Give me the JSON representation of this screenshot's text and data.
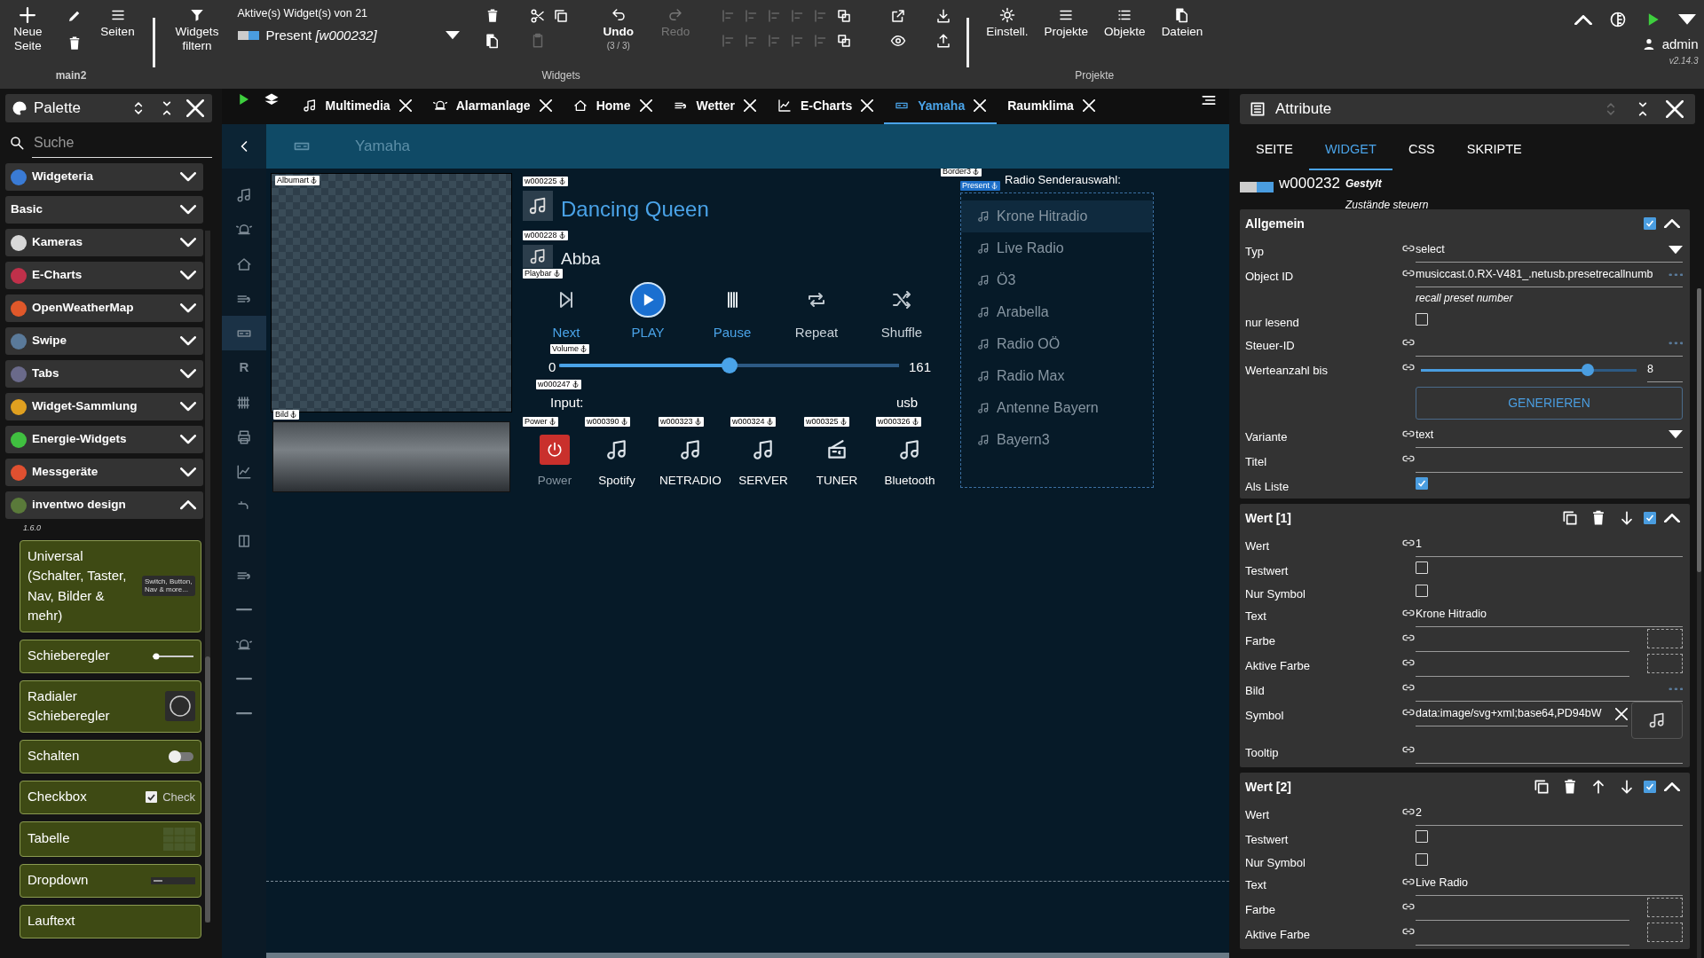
{
  "toolbar": {
    "page_buttons": [
      {
        "kind": "plus",
        "label": "Neue Seite"
      },
      {
        "kind": "pencil"
      },
      {
        "kind": "trash"
      },
      {
        "kind": "menu",
        "label": "Seiten"
      }
    ],
    "page_caption": "main2",
    "filter_button": "Widgets filtern",
    "active_widgets": {
      "label": "Aktive(s) Widget(s) von 21",
      "value": "Present *[w000232]*"
    },
    "edit_tools": [
      [
        {
          "kind": "trash",
          "disabled": false
        },
        {
          "kind": "files",
          "disabled": false
        }
      ],
      [
        {
          "kind": "cut",
          "disabled": false
        },
        {
          "kind": "copy",
          "disabled": false
        },
        {
          "kind": "paste",
          "disabled": true
        }
      ]
    ],
    "undo": {
      "label": "Undo",
      "count": "(3 / 3)",
      "disabled": false
    },
    "redo": {
      "label": "Redo",
      "disabled": true
    },
    "arrange_tools": [
      [
        {
          "kind": "align",
          "disabled": true
        },
        {
          "kind": "align",
          "disabled": true
        },
        {
          "kind": "align",
          "disabled": true
        },
        {
          "kind": "align",
          "disabled": true
        },
        {
          "kind": "align",
          "disabled": true
        },
        {
          "kind": "layers",
          "disabled": false
        },
        {
          "kind": "align",
          "disabled": true
        },
        {
          "kind": "align",
          "disabled": true
        },
        {
          "kind": "align",
          "disabled": true
        },
        {
          "kind": "align",
          "disabled": true
        },
        {
          "kind": "align",
          "disabled": true
        },
        {
          "kind": "layers",
          "disabled": false
        }
      ],
      [
        {
          "kind": "external",
          "disabled": false
        },
        {
          "kind": "eye",
          "disabled": false
        }
      ],
      [
        {
          "kind": "download",
          "disabled": false
        },
        {
          "kind": "upload",
          "disabled": false
        }
      ]
    ],
    "widgets_caption": "Widgets",
    "project_buttons": [
      {
        "kind": "gear",
        "label": "Einstell."
      },
      {
        "kind": "menu",
        "label": "Projekte"
      },
      {
        "kind": "list",
        "label": "Objekte"
      },
      {
        "kind": "files",
        "label": "Dateien"
      }
    ],
    "projects_caption": "Projekte",
    "user": "admin",
    "version": "v2.14.3"
  },
  "palette": {
    "title": "Palette",
    "search": {
      "placeholder": "Suche"
    },
    "categories": [
      {
        "name": "Widgeteria",
        "expanded": false,
        "color": "#3a7bd5"
      },
      {
        "name": "Basic",
        "expanded": false
      },
      {
        "name": "Kameras",
        "expanded": false,
        "color": "#d8d8d8"
      },
      {
        "name": "E-Charts",
        "expanded": false,
        "color": "#c0304a"
      },
      {
        "name": "OpenWeatherMap",
        "expanded": false,
        "color": "#e0582a"
      },
      {
        "name": "Swipe",
        "expanded": false,
        "color": "#5a7a9a"
      },
      {
        "name": "Tabs",
        "expanded": false,
        "color": "#6a6a8a"
      },
      {
        "name": "Widget-Sammlung",
        "expanded": false,
        "color": "#e0a020"
      },
      {
        "name": "Energie-Widgets",
        "expanded": false,
        "color": "#40c040"
      },
      {
        "name": "Messgeräte",
        "expanded": false,
        "color": "#e05030"
      },
      {
        "name": "inventwo design",
        "expanded": true,
        "color": "#5a7a3a",
        "version": "1.6.0",
        "widgets": [
          {
            "name": "Universal (Schalter, Taster, Nav, Bilder & mehr)",
            "kind": "universal",
            "preview": "Switch, Button, Nav & more..."
          },
          {
            "name": "Schieberegler",
            "kind": "slider"
          },
          {
            "name": "Radialer Schieberegler",
            "kind": "radial"
          },
          {
            "name": "Schalten",
            "kind": "switch"
          },
          {
            "name": "Checkbox",
            "kind": "checkbox",
            "preview": "Check"
          },
          {
            "name": "Tabelle",
            "kind": "table"
          },
          {
            "name": "Dropdown",
            "kind": "dropdown"
          },
          {
            "name": "Lauftext",
            "kind": "text"
          }
        ]
      }
    ]
  },
  "views": {
    "tabs": [
      {
        "label": "Multimedia",
        "kind": "music",
        "selected": false
      },
      {
        "label": "Alarmanlage",
        "kind": "alarm",
        "selected": false
      },
      {
        "label": "Home",
        "kind": "home",
        "selected": false
      },
      {
        "label": "Wetter",
        "kind": "weather",
        "selected": false
      },
      {
        "label": "E-Charts",
        "kind": "chart",
        "selected": false
      },
      {
        "label": "Yamaha",
        "kind": "receiver",
        "selected": true
      },
      {
        "label": "Raumklima",
        "selected": false
      }
    ],
    "header": "Yamaha",
    "side_nav": [
      {
        "kind": "music",
        "selected": false
      },
      {
        "kind": "alarm",
        "selected": false
      },
      {
        "kind": "home",
        "selected": false
      },
      {
        "kind": "weather",
        "selected": false
      },
      {
        "kind": "receiver",
        "selected": true
      },
      {
        "kind": "letter",
        "label": "R",
        "selected": false
      },
      {
        "kind": "radiator",
        "selected": false
      },
      {
        "kind": "printer",
        "selected": false
      },
      {
        "kind": "chart",
        "selected": false
      },
      {
        "kind": "tap",
        "selected": false
      },
      {
        "kind": "panel",
        "selected": false
      },
      {
        "kind": "weather",
        "selected": false
      },
      {
        "kind": "dash",
        "selected": false
      },
      {
        "kind": "alarm",
        "selected": false
      },
      {
        "kind": "dash",
        "selected": false
      },
      {
        "kind": "dash",
        "selected": false
      }
    ]
  },
  "canvas": {
    "albumart": {
      "tag": "Albumart"
    },
    "receiver_image": {
      "tag": "Bild"
    },
    "title": {
      "tag": "w000225",
      "text": "Dancing Queen"
    },
    "artist": {
      "tag": "w000228",
      "text": "Abba"
    },
    "playbar": {
      "tag": "Playbar",
      "buttons": [
        {
          "kind": "next",
          "label": "Next"
        },
        {
          "kind": "play",
          "label": "PLAY"
        },
        {
          "kind": "pause",
          "label": "Pause"
        },
        {
          "kind": "repeat",
          "label": "Repeat"
        },
        {
          "kind": "shuffle",
          "label": "Shuffle"
        }
      ]
    },
    "volume": {
      "tag": "Volume",
      "min": "0",
      "max": "161",
      "level": 0.5
    },
    "input": {
      "tag": "w000247",
      "label": "Input:",
      "value": "usb"
    },
    "sources": [
      {
        "kind": "power",
        "tag": "Power",
        "label": "Power"
      },
      {
        "kind": "music",
        "tag": "w000390",
        "label": "Spotify"
      },
      {
        "kind": "music",
        "tag": "w000323",
        "label": "NETRADIO"
      },
      {
        "kind": "music",
        "tag": "w000324",
        "label": "SERVER"
      },
      {
        "kind": "radio",
        "tag": "w000325",
        "label": "TUNER"
      },
      {
        "kind": "music",
        "tag": "w000326",
        "label": "Bluetooth"
      }
    ],
    "radio": {
      "tags": [
        "Border3",
        "Present"
      ],
      "title": "Radio Senderauswahl:",
      "stations": [
        {
          "name": "Krone Hitradio",
          "selected": true
        },
        {
          "name": "Live Radio",
          "selected": false
        },
        {
          "name": "Ö3",
          "selected": false
        },
        {
          "name": "Arabella",
          "selected": false
        },
        {
          "name": "Radio OÖ",
          "selected": false
        },
        {
          "name": "Radio Max",
          "selected": false
        },
        {
          "name": "Antenne Bayern",
          "selected": false
        },
        {
          "name": "Bayern3",
          "selected": false
        }
      ]
    }
  },
  "attributes": {
    "title": "Attribute",
    "tabs": [
      {
        "label": "SEITE",
        "selected": false
      },
      {
        "label": "WIDGET",
        "selected": true
      },
      {
        "label": "CSS",
        "selected": false
      },
      {
        "label": "SKRIPTE",
        "selected": false
      }
    ],
    "widget": {
      "id": "w000232",
      "styled": "Gestylt",
      "states": "Zustände steuern"
    },
    "sections": [
      {
        "title": "Allgemein",
        "enabled": true,
        "expanded": true,
        "fields": [
          {
            "label": "Typ",
            "kind": "select",
            "binding": true,
            "value": "select"
          },
          {
            "label": "Object ID",
            "kind": "text",
            "binding": true,
            "value": "musiccast.0.RX-V481_.netusb.presetrecallnumb",
            "more": true,
            "hint": "recall preset number"
          },
          {
            "label": "nur lesend",
            "kind": "checkbox",
            "binding": false,
            "checked": false
          },
          {
            "label": "Steuer-ID",
            "kind": "text",
            "binding": true,
            "more": true
          },
          {
            "label": "Werteanzahl bis",
            "kind": "slider",
            "binding": true,
            "level": 0.79,
            "value": "8"
          },
          {
            "kind": "button",
            "text": "GENERIEREN"
          },
          {
            "label": "Variante",
            "kind": "select",
            "binding": true,
            "value": "text"
          },
          {
            "label": "Titel",
            "kind": "text",
            "binding": true
          },
          {
            "label": "Als Liste",
            "kind": "checkbox",
            "binding": false,
            "checked": true
          }
        ]
      },
      {
        "title": "Wert [1]",
        "actions": [
          {
            "kind": "copy"
          },
          {
            "kind": "trash"
          },
          {
            "kind": "arrowdown"
          }
        ],
        "enabled": true,
        "expanded": true,
        "fields": [
          {
            "label": "Wert",
            "kind": "text",
            "binding": true,
            "value": "1"
          },
          {
            "label": "Testwert",
            "kind": "checkbox",
            "binding": false,
            "checked": false
          },
          {
            "label": "Nur Symbol",
            "kind": "checkbox",
            "binding": false,
            "checked": false
          },
          {
            "label": "Text",
            "kind": "text",
            "binding": true,
            "value": "Krone Hitradio"
          },
          {
            "label": "Farbe",
            "kind": "color",
            "binding": true
          },
          {
            "label": "Aktive Farbe",
            "kind": "color",
            "binding": true
          },
          {
            "label": "Bild",
            "kind": "text",
            "binding": true,
            "more": true
          },
          {
            "label": "Symbol",
            "kind": "icon",
            "binding": true,
            "value": "data:image/svg+xml;base64,PD94bW"
          },
          {
            "label": "Tooltip",
            "kind": "text",
            "binding": true
          }
        ]
      },
      {
        "title": "Wert [2]",
        "actions": [
          {
            "kind": "copy"
          },
          {
            "kind": "trash"
          },
          {
            "kind": "arrowup"
          },
          {
            "kind": "arrowdown"
          }
        ],
        "enabled": true,
        "expanded": true,
        "fields": [
          {
            "label": "Wert",
            "kind": "text",
            "binding": true,
            "value": "2"
          },
          {
            "label": "Testwert",
            "kind": "checkbox",
            "binding": false,
            "checked": false
          },
          {
            "label": "Nur Symbol",
            "kind": "checkbox",
            "binding": false,
            "checked": false
          },
          {
            "label": "Text",
            "kind": "text",
            "binding": true,
            "value": "Live Radio"
          },
          {
            "label": "Farbe",
            "kind": "color",
            "binding": true
          },
          {
            "label": "Aktive Farbe",
            "kind": "color",
            "binding": true
          }
        ]
      }
    ]
  }
}
